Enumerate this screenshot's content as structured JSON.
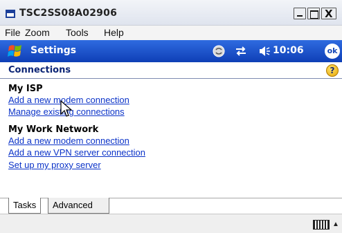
{
  "window": {
    "title": "TSC2SS08A02906",
    "close_glyph": "X"
  },
  "menubar": {
    "items": [
      "File",
      "Zoom",
      "Tools",
      "Help"
    ]
  },
  "device_bar": {
    "title": "Settings",
    "time": "10:06",
    "ok_label": "ok",
    "icons": [
      "windows-start-icon",
      "sync-icon",
      "connectivity-icon",
      "volume-icon"
    ]
  },
  "page": {
    "title": "Connections",
    "help_glyph": "?"
  },
  "sections": [
    {
      "heading": "My ISP",
      "links": [
        "Add a new modem connection",
        "Manage existing connections"
      ]
    },
    {
      "heading": "My Work Network",
      "links": [
        "Add a new modem connection",
        "Add a new VPN server connection",
        "Set up my proxy server"
      ]
    }
  ],
  "tabs": [
    "Tasks",
    "Advanced"
  ],
  "colors": {
    "nav_bar": "#1a4fc7",
    "link": "#0b33c8",
    "page_title": "#0b2475"
  }
}
